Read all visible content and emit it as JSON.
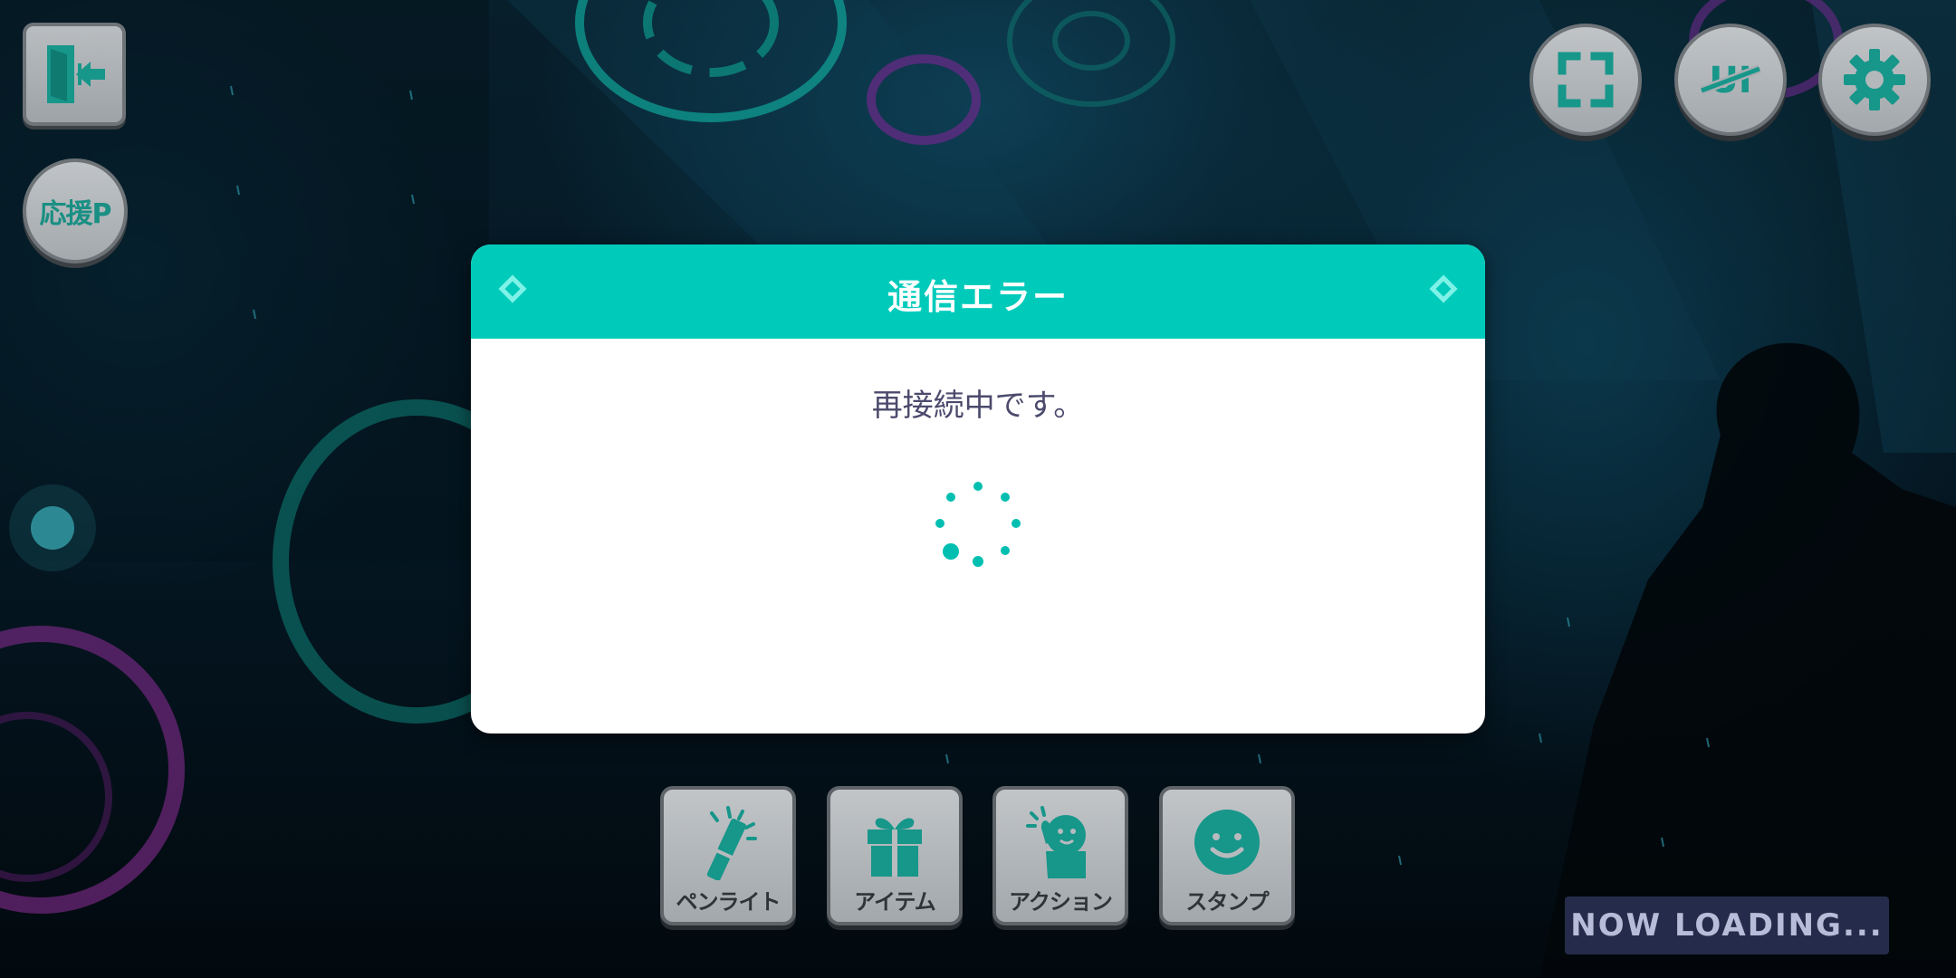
{
  "top_left": {
    "exit_icon": "exit-door-icon",
    "support_label": "応援P"
  },
  "top_right": {
    "fullscreen_icon": "fullscreen-icon",
    "ui_toggle_icon": "ui-hide-icon",
    "settings_icon": "gear-icon"
  },
  "dialog": {
    "title": "通信エラー",
    "message": "再接続中です。",
    "accent_color": "#00cbbb",
    "spinner_icon": "loading-spinner-icon"
  },
  "actions": [
    {
      "label": "ペンライト",
      "icon": "penlight-icon"
    },
    {
      "label": "アイテム",
      "icon": "gift-icon"
    },
    {
      "label": "アクション",
      "icon": "action-pose-icon"
    },
    {
      "label": "スタンプ",
      "icon": "smiley-stamp-icon"
    }
  ],
  "status": {
    "loading_text": "NOW LOADING..."
  }
}
